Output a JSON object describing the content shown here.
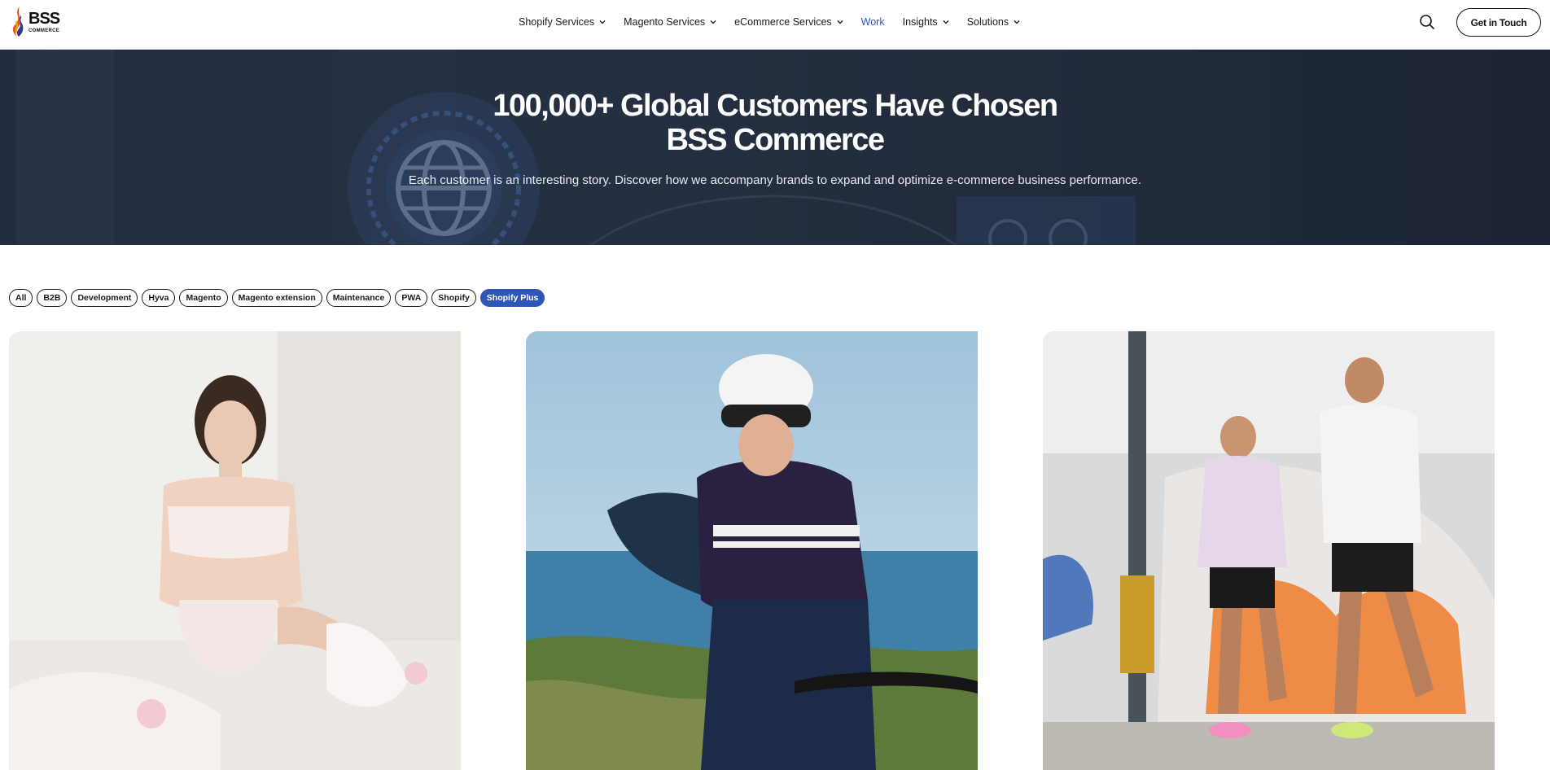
{
  "brand": {
    "name": "BSS",
    "tagline": "COMMERCE"
  },
  "nav": {
    "items": [
      {
        "label": "Shopify Services",
        "has_dropdown": true
      },
      {
        "label": "Magento Services",
        "has_dropdown": true
      },
      {
        "label": "eCommerce Services",
        "has_dropdown": true
      },
      {
        "label": "Work",
        "has_dropdown": false,
        "active": true
      },
      {
        "label": "Insights",
        "has_dropdown": true
      },
      {
        "label": "Solutions",
        "has_dropdown": true
      }
    ],
    "search_icon": "search-icon",
    "cta_label": "Get in Touch"
  },
  "hero": {
    "title_line1": "100,000+ Global Customers Have Chosen",
    "title_line2": "BSS Commerce",
    "subtitle": "Each customer is an interesting story. Discover how we accompany brands to expand and optimize e-commerce business performance."
  },
  "filters": {
    "items": [
      "All",
      "B2B",
      "Development",
      "Hyva",
      "Magento",
      "Magento extension",
      "Maintenance",
      "PWA",
      "Shopify",
      "Shopify Plus"
    ],
    "selected": "Shopify Plus"
  },
  "cards": [
    {
      "image": "lingerie-model-photo"
    },
    {
      "image": "cyclist-photo"
    },
    {
      "image": "runners-photo"
    }
  ],
  "colors": {
    "accent": "#2e56b8",
    "hero_bg": "#222c3d",
    "text": "#1a1a1a"
  }
}
